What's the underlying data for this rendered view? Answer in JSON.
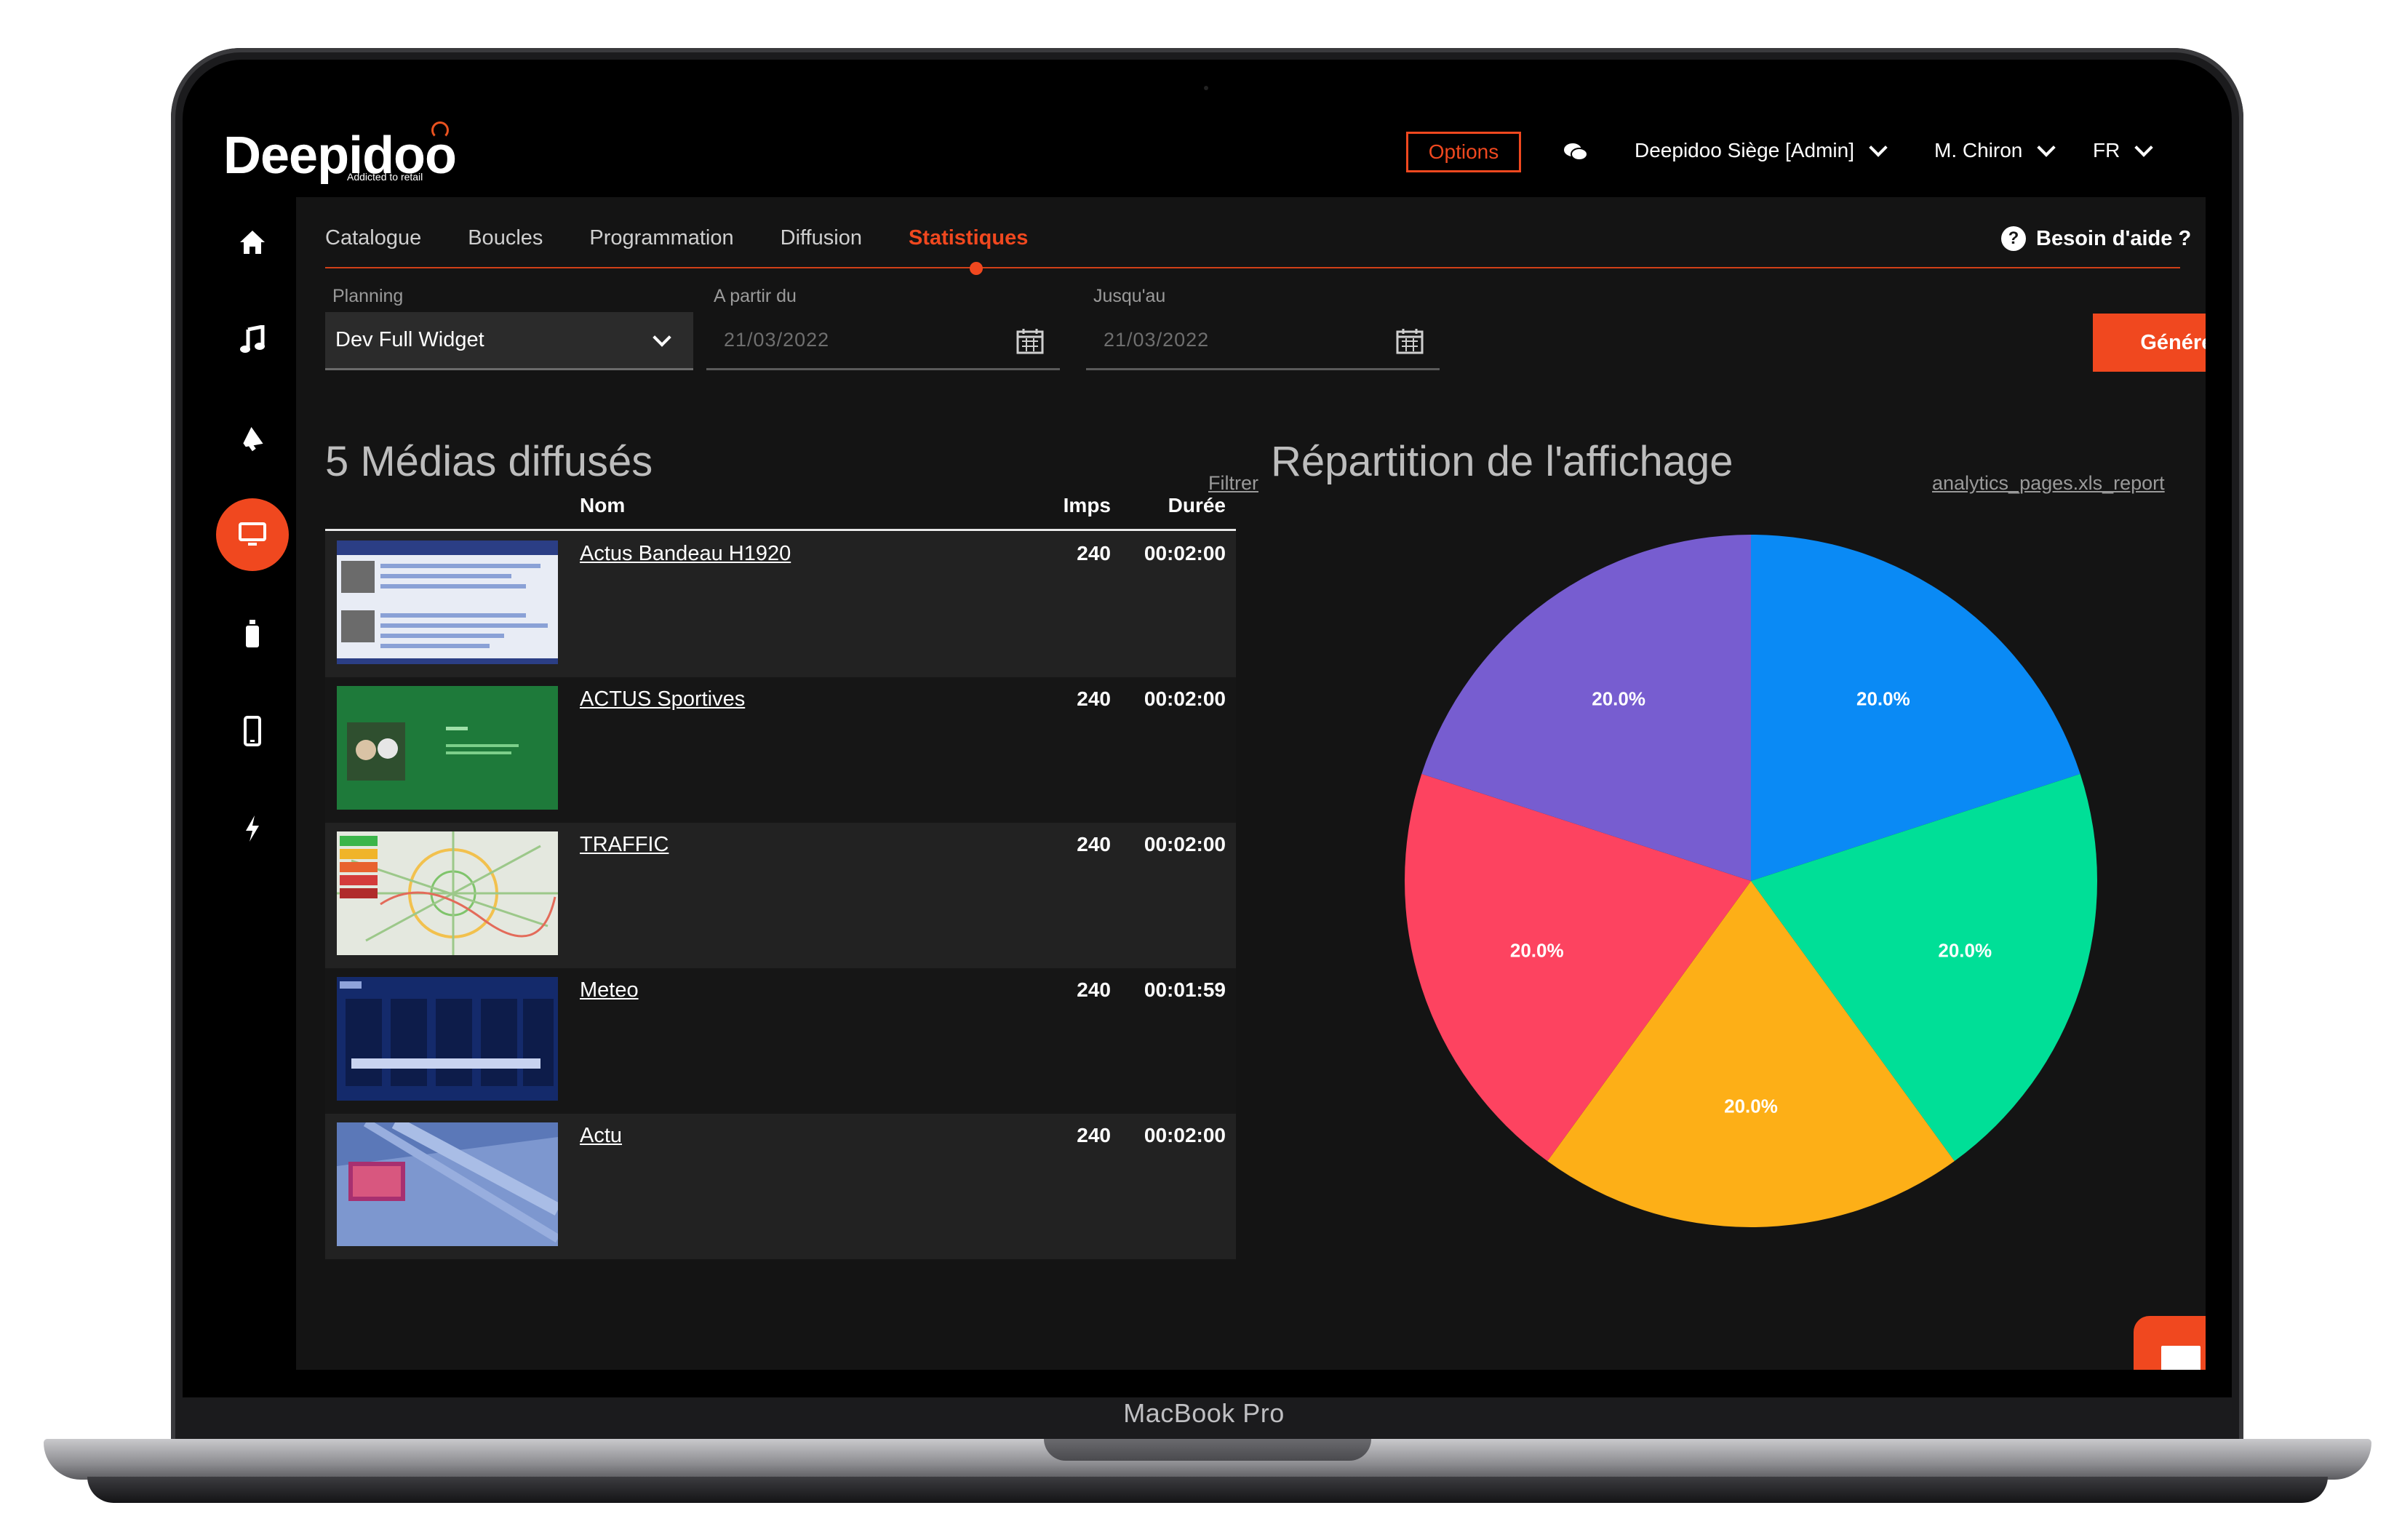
{
  "device": {
    "label": "MacBook Pro"
  },
  "header": {
    "logo_text": "Deepidoo",
    "logo_tagline": "Addicted to retail",
    "options_label": "Options",
    "site_selector": "Deepidoo Siège [Admin]",
    "user_menu": "M. Chiron",
    "language": "FR"
  },
  "sidebar": {
    "items": [
      {
        "icon": "home-icon"
      },
      {
        "icon": "music-icon"
      },
      {
        "icon": "megaphone-icon"
      },
      {
        "icon": "monitor-icon",
        "active": true
      },
      {
        "icon": "spray-bottle-icon"
      },
      {
        "icon": "smartphone-icon"
      },
      {
        "icon": "lightning-icon"
      }
    ]
  },
  "tabs": [
    {
      "label": "Catalogue"
    },
    {
      "label": "Boucles"
    },
    {
      "label": "Programmation"
    },
    {
      "label": "Diffusion"
    },
    {
      "label": "Statistiques",
      "active": true
    }
  ],
  "help_label": "Besoin d'aide ?",
  "filters": {
    "planning_label": "Planning",
    "planning_value": "Dev Full Widget",
    "from_label": "A partir du",
    "from_placeholder": "21/03/2022",
    "to_label": "Jusqu'au",
    "to_placeholder": "21/03/2022",
    "generate_label": "Générer"
  },
  "media_section": {
    "title": "5 Médias diffusés",
    "filter_link": "Filtrer",
    "columns": {
      "name": "Nom",
      "imps": "Imps",
      "duration": "Durée"
    },
    "rows": [
      {
        "name": "Actus Bandeau H1920",
        "imps": "240",
        "duration": "00:02:00"
      },
      {
        "name": "ACTUS Sportives",
        "imps": "240",
        "duration": "00:02:00"
      },
      {
        "name": "TRAFFIC",
        "imps": "240",
        "duration": "00:02:00"
      },
      {
        "name": "Meteo",
        "imps": "240",
        "duration": "00:01:59"
      },
      {
        "name": "Actu",
        "imps": "240",
        "duration": "00:02:00"
      }
    ]
  },
  "chart_section": {
    "title": "Répartition de l'affichage",
    "report_link": "analytics_pages.xls_report"
  },
  "colors": {
    "accent": "#f0481f"
  },
  "chart_data": {
    "type": "pie",
    "slices": [
      {
        "value": 20.0,
        "label": "20.0%",
        "color": "#0a8af5"
      },
      {
        "value": 20.0,
        "label": "20.0%",
        "color": "#00df97"
      },
      {
        "value": 20.0,
        "label": "20.0%",
        "color": "#fdaf17"
      },
      {
        "value": 20.0,
        "label": "20.0%",
        "color": "#fd4360"
      },
      {
        "value": 20.0,
        "label": "20.0%",
        "color": "#775dd0"
      }
    ]
  }
}
